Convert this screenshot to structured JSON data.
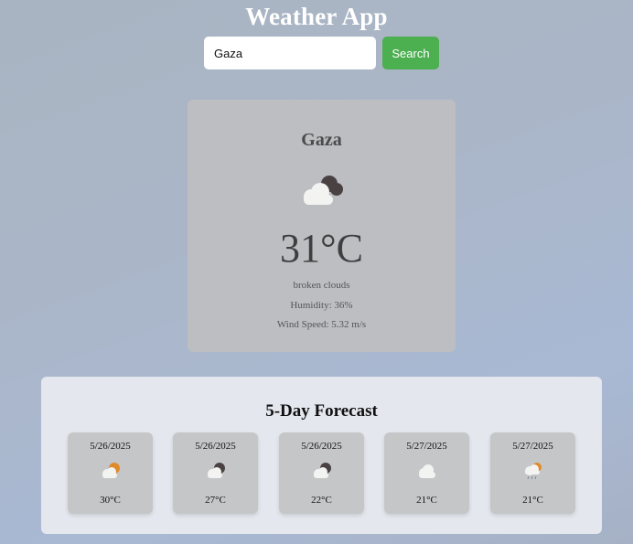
{
  "app": {
    "title": "Weather App"
  },
  "search": {
    "value": "Gaza",
    "button_label": "Search"
  },
  "current": {
    "city": "Gaza",
    "icon": "broken-clouds-icon",
    "temperature": "31°C",
    "description": "broken clouds",
    "humidity": "Humidity: 36%",
    "wind": "Wind Speed: 5.32 m/s"
  },
  "forecast": {
    "title": "5-Day Forecast",
    "days": [
      {
        "date": "5/26/2025",
        "icon": "few-clouds-day-icon",
        "temp": "30°C"
      },
      {
        "date": "5/26/2025",
        "icon": "few-clouds-night-icon",
        "temp": "27°C"
      },
      {
        "date": "5/26/2025",
        "icon": "few-clouds-night-icon",
        "temp": "22°C"
      },
      {
        "date": "5/27/2025",
        "icon": "clouds-icon",
        "temp": "21°C"
      },
      {
        "date": "5/27/2025",
        "icon": "light-rain-day-icon",
        "temp": "21°C"
      }
    ]
  },
  "colors": {
    "search_button": "#4caf50",
    "card_background": "#bcbec2",
    "forecast_panel": "#e4e8ee",
    "sun": "#e08a2a"
  }
}
